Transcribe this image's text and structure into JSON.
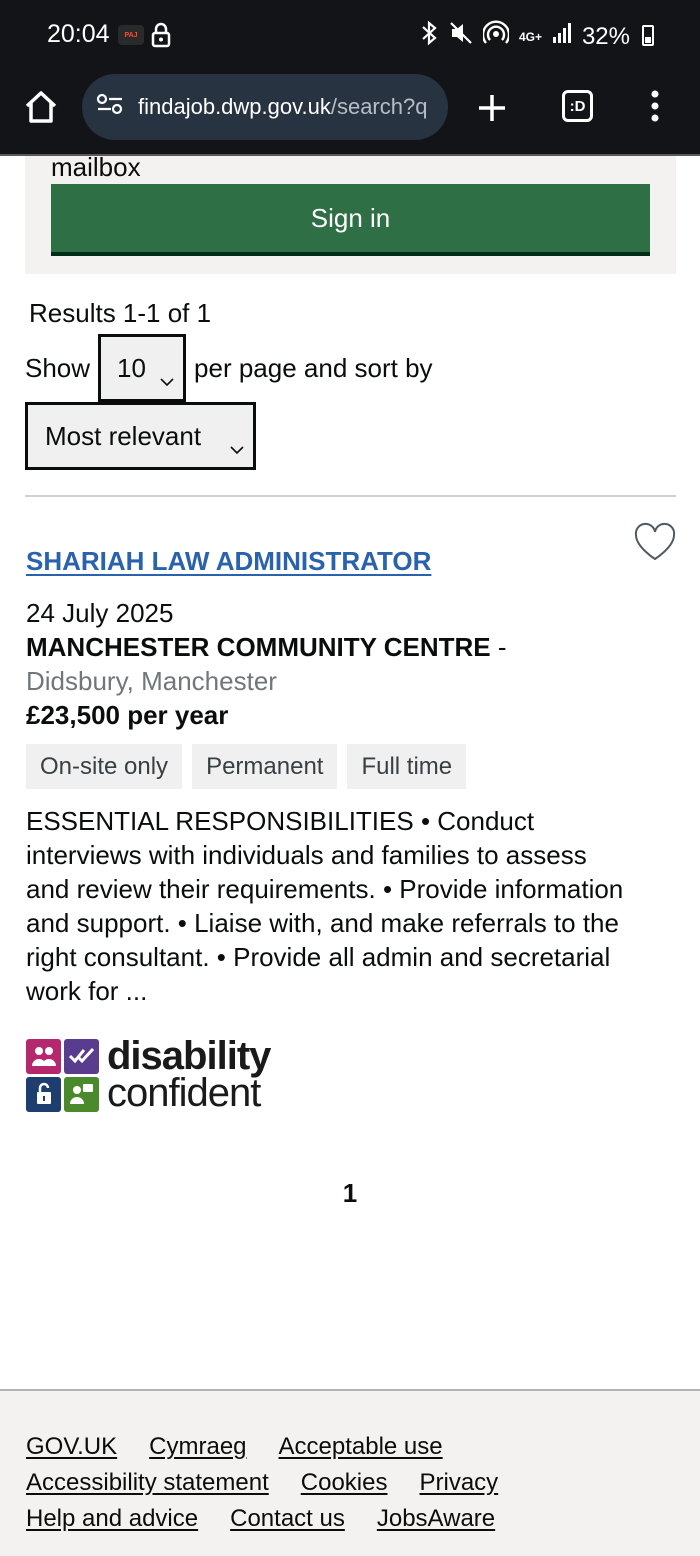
{
  "status_bar": {
    "time": "20:04",
    "notification_badge": "PAJ",
    "network": "4G+",
    "battery": "32%"
  },
  "browser": {
    "url_host": "findajob.dwp.gov.uk",
    "url_path": "/search?q",
    "tab_label": ":D"
  },
  "signin": {
    "mailbox_text": "mailbox",
    "button_label": "Sign in"
  },
  "results": {
    "summary": "Results 1-1 of 1",
    "show_label": "Show",
    "per_page_value": "10",
    "per_page_suffix": "per page and sort by",
    "sort_value": "Most relevant"
  },
  "job": {
    "title": "SHARIAH LAW ADMINISTRATOR",
    "date": "24 July 2025",
    "company": "MANCHESTER COMMUNITY CENTRE",
    "company_dash": "-",
    "location": "Didsbury, Manchester",
    "salary": "£23,500 per year",
    "tags": [
      "On-site only",
      "Permanent",
      "Full time"
    ],
    "description": "ESSENTIAL RESPONSIBILITIES • Conduct interviews with individuals and families to assess and review their requirements. • Provide information and support. • Liaise with, and make referrals to the right consultant. • Provide all admin and secretarial work for ...",
    "logo_word1": "disability",
    "logo_word2": "confident",
    "logo_colors": [
      "#b5286e",
      "#5a3c8e",
      "#1d3e6f",
      "#4a8a2c"
    ]
  },
  "pagination": {
    "current_page": "1"
  },
  "footer": {
    "links": [
      "GOV.UK",
      "Cymraeg",
      "Acceptable use",
      "Accessibility statement",
      "Cookies",
      "Privacy",
      "Help and advice",
      "Contact us",
      "JobsAware"
    ]
  }
}
